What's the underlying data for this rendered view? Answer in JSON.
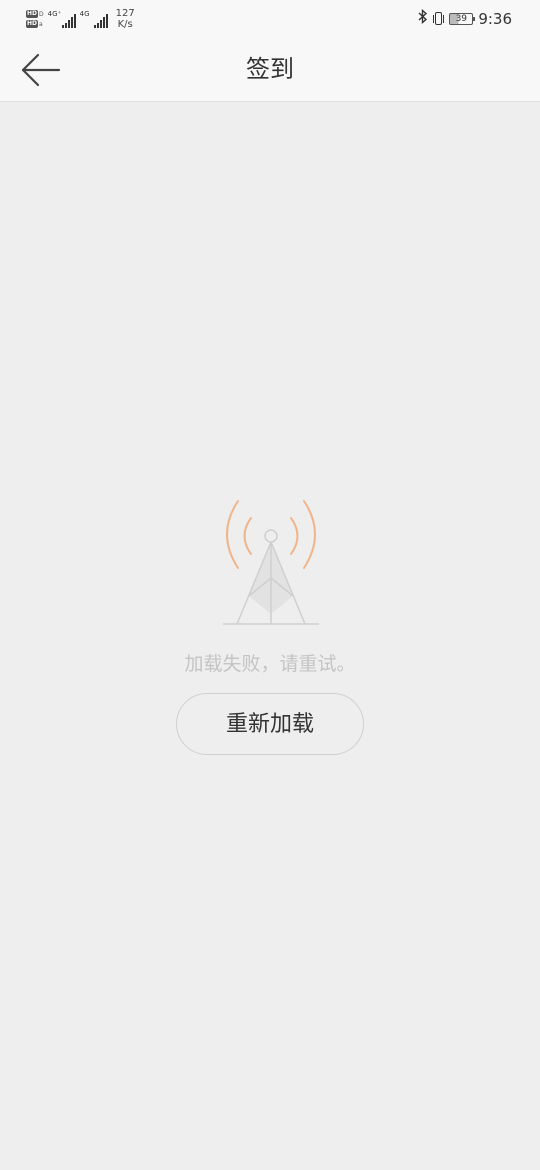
{
  "status_bar": {
    "hd_label": "HD",
    "network_type_1": "4G⁺",
    "network_type_2": "4G",
    "speed_value": "127",
    "speed_unit": "K/s",
    "battery_level": "39",
    "time": "9:36"
  },
  "header": {
    "title": "签到",
    "back_icon": "arrow-left-icon"
  },
  "error_state": {
    "icon": "signal-tower-icon",
    "message": "加载失败，请重试。",
    "retry_label": "重新加载"
  },
  "colors": {
    "background": "#eeeeee",
    "header_background": "#f8f8f8",
    "signal_wave": "#f0b48a",
    "tower_line": "#cfcfcf",
    "message_text": "#c4c4c4"
  }
}
